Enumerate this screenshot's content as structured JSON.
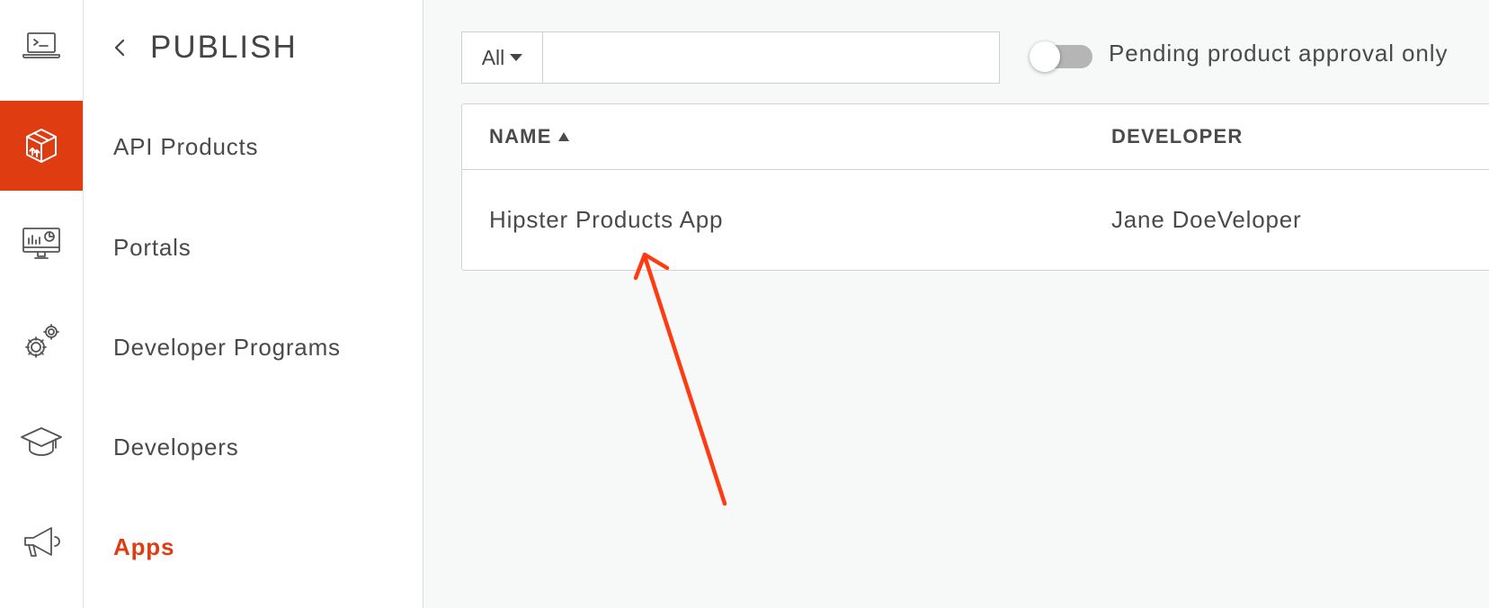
{
  "colors": {
    "accent": "#e03c12",
    "icon_stroke": "#555555",
    "arrow": "#ff3b12"
  },
  "rail": {
    "items": [
      {
        "icon": "terminal-laptop-icon",
        "active": false
      },
      {
        "icon": "package-box-icon",
        "active": true
      },
      {
        "icon": "analytics-monitor-icon",
        "active": false
      },
      {
        "icon": "gears-icon",
        "active": false
      },
      {
        "icon": "graduation-cap-icon",
        "active": false
      },
      {
        "icon": "megaphone-icon",
        "active": false
      }
    ]
  },
  "nav": {
    "title": "PUBLISH",
    "back_icon": "chevron-left-icon",
    "items": [
      {
        "label": "API Products",
        "active": false
      },
      {
        "label": "Portals",
        "active": false
      },
      {
        "label": "Developer Programs",
        "active": false
      },
      {
        "label": "Developers",
        "active": false
      },
      {
        "label": "Apps",
        "active": true
      }
    ]
  },
  "filter": {
    "selected": "All",
    "search_value": "",
    "search_placeholder": "",
    "toggle_label": "Pending product approval only",
    "toggle_on": false
  },
  "table": {
    "columns": [
      {
        "label": "NAME",
        "sort": "asc"
      },
      {
        "label": "DEVELOPER"
      }
    ],
    "rows": [
      {
        "name": "Hipster Products App",
        "developer": "Jane DoeVeloper"
      }
    ]
  }
}
